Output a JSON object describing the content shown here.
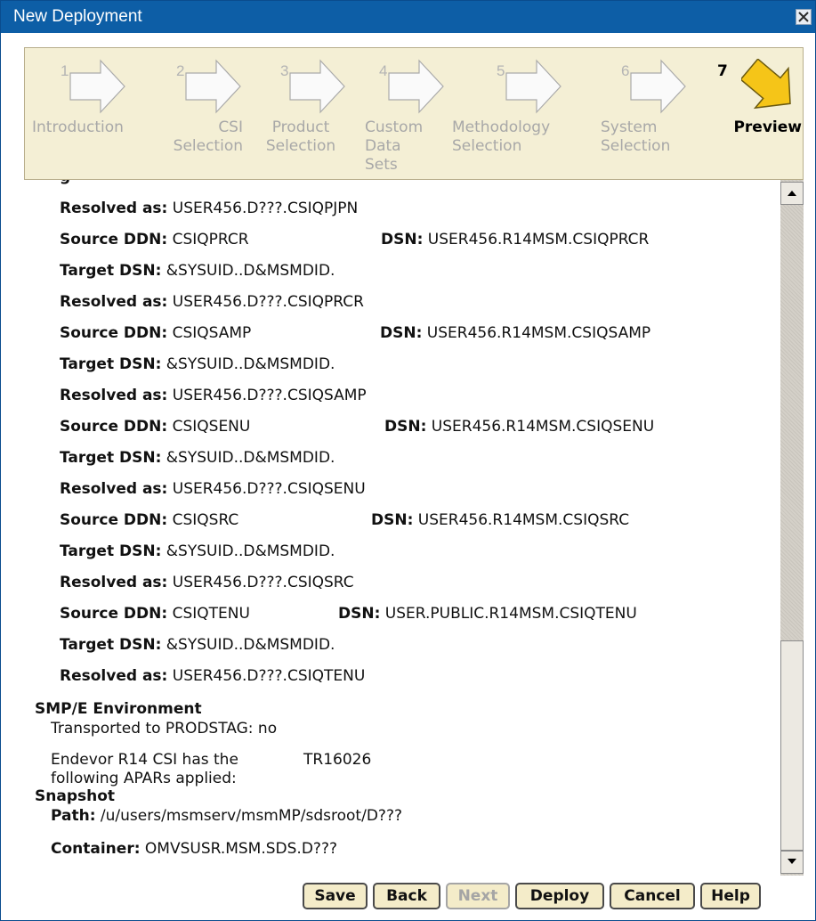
{
  "window": {
    "title": "New Deployment"
  },
  "wizard": {
    "steps": [
      {
        "num": "1",
        "label": "Introduction"
      },
      {
        "num": "2",
        "label": "CSI Selection"
      },
      {
        "num": "3",
        "label": "Product Selection"
      },
      {
        "num": "4",
        "label": "Custom Data Sets"
      },
      {
        "num": "5",
        "label": "Methodology Selection"
      },
      {
        "num": "6",
        "label": "System Selection"
      },
      {
        "num": "7",
        "label": "Preview",
        "current": true
      }
    ]
  },
  "labels": {
    "resolved_as": "Resolved as:",
    "source_ddn": "Source DDN:",
    "dsn": "DSN:",
    "target_dsn": "Target DSN:"
  },
  "datasets": [
    {
      "resolved": "USER456.D???.CSIQPJPN"
    },
    {
      "source_ddn": "CSIQPRCR",
      "dsn": "USER456.R14MSM.CSIQPRCR",
      "target": "&SYSUID..D&MSMDID.",
      "resolved": "USER456.D???.CSIQPRCR"
    },
    {
      "source_ddn": "CSIQSAMP",
      "dsn": "USER456.R14MSM.CSIQSAMP",
      "target": "&SYSUID..D&MSMDID.",
      "resolved": "USER456.D???.CSIQSAMP"
    },
    {
      "source_ddn": "CSIQSENU",
      "dsn": "USER456.R14MSM.CSIQSENU",
      "target": "&SYSUID..D&MSMDID.",
      "resolved": "USER456.D???.CSIQSENU"
    },
    {
      "source_ddn": "CSIQSRC",
      "dsn": "USER456.R14MSM.CSIQSRC",
      "target": "&SYSUID..D&MSMDID.",
      "resolved": "USER456.D???.CSIQSRC"
    },
    {
      "source_ddn": "CSIQTENU",
      "dsn": "USER.PUBLIC.R14MSM.CSIQTENU",
      "target": "&SYSUID..D&MSMDID.",
      "resolved": "USER456.D???.CSIQTENU"
    }
  ],
  "smpe": {
    "heading": "SMP/E Environment",
    "transported": "Transported to PRODSTAG: no",
    "apars_label_line1": "Endevor R14 CSI has the",
    "apars_label_line2": "following APARs applied:",
    "apars_value": "TR16026"
  },
  "snapshot": {
    "heading": "Snapshot",
    "path_label": "Path:",
    "path_value": "/u/users/msmserv/msmMP/sdsroot/D???",
    "container_label": "Container:",
    "container_value": "OMVSUSR.MSM.SDS.D???"
  },
  "buttons": {
    "save": "Save",
    "back": "Back",
    "next": "Next",
    "deploy": "Deploy",
    "cancel": "Cancel",
    "help": "Help"
  },
  "colors": {
    "titlebar": "#0d5ea6",
    "wizard_bg": "#f4efd5",
    "current_step_arrow": "#f5c518",
    "button_bg": "#f4ecc9"
  }
}
